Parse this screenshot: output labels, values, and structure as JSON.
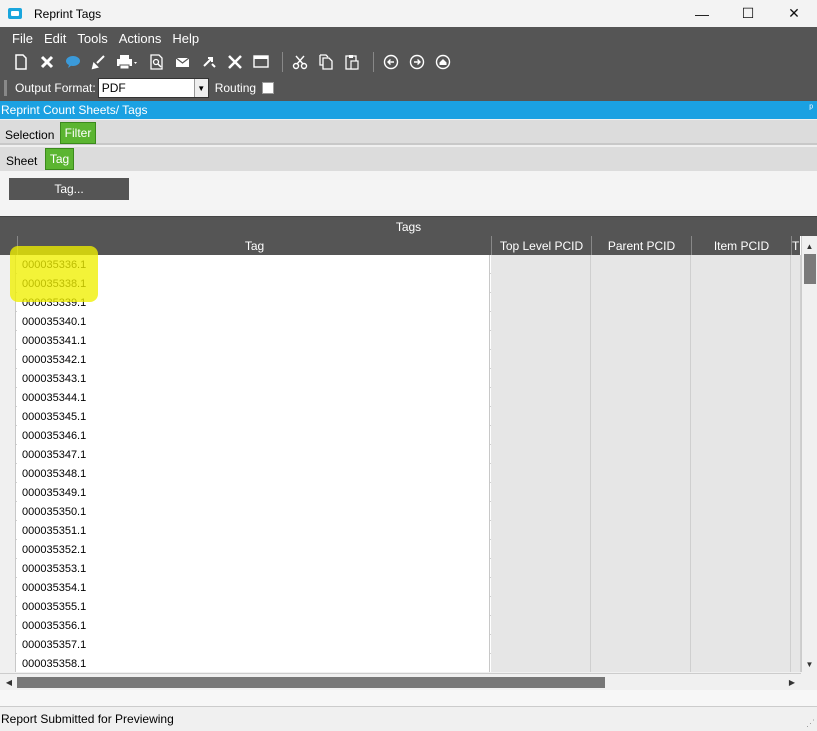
{
  "window": {
    "title": "Reprint Tags",
    "minimize": "—",
    "maximize": "☐",
    "close": "✕"
  },
  "menu": [
    "File",
    "Edit",
    "Tools",
    "Actions",
    "Help"
  ],
  "toolbar": {
    "icons": [
      "new-icon",
      "delete-icon",
      "chat-icon",
      "clear-icon",
      "print-icon",
      "print-preview-icon",
      "email-icon",
      "attach-icon",
      "tools-icon",
      "window-icon",
      "cut-icon",
      "copy-icon",
      "paste-icon",
      "back-icon",
      "forward-icon",
      "home-icon"
    ]
  },
  "format_bar": {
    "output_format_label": "Output Format:",
    "output_format_value": "PDF",
    "routing_label": "Routing",
    "routing_checked": false
  },
  "panel": {
    "title": "Reprint Count Sheets/ Tags",
    "pin": "ᵖ"
  },
  "tabs_top": [
    "Selection",
    "Filter"
  ],
  "tabs_top_active": "Filter",
  "tabs_sub": [
    "Sheet",
    "Tag"
  ],
  "tabs_sub_active": "Tag",
  "filter": {
    "tag_button_label": "Tag..."
  },
  "grid": {
    "title": "Tags",
    "columns": [
      "Tag",
      "Top Level PCID",
      "Parent PCID",
      "Item PCID",
      "T"
    ],
    "rows": [
      "000035336.1",
      "000035338.1",
      "000035339.1",
      "000035340.1",
      "000035341.1",
      "000035342.1",
      "000035343.1",
      "000035344.1",
      "000035345.1",
      "000035346.1",
      "000035347.1",
      "000035348.1",
      "000035349.1",
      "000035350.1",
      "000035351.1",
      "000035352.1",
      "000035353.1",
      "000035354.1",
      "000035355.1",
      "000035356.1",
      "000035357.1",
      "000035358.1"
    ],
    "highlighted_rows": [
      0,
      1
    ],
    "highlight_color": "#f0f000"
  },
  "status": {
    "message": "Report Submitted for Previewing"
  },
  "colors": {
    "toolbar_bg": "#555555",
    "panel_header": "#1ba1e2",
    "active_tab": "#5bb531"
  }
}
